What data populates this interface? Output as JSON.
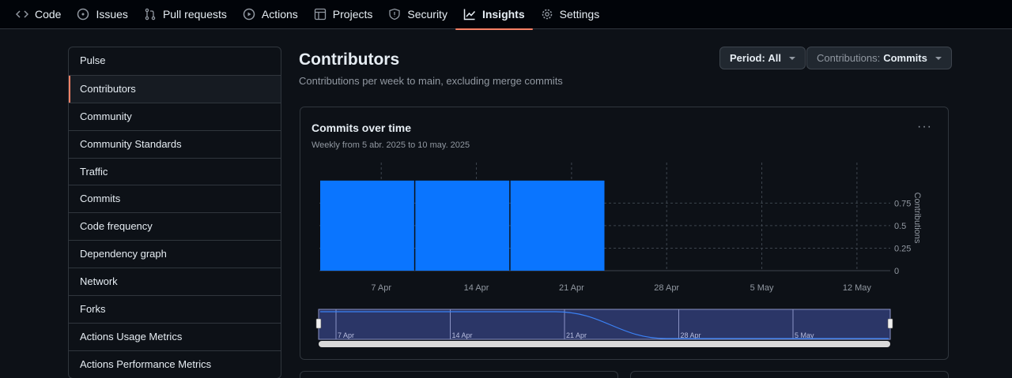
{
  "nav": {
    "tabs": [
      {
        "label": "Code",
        "icon": "code-icon"
      },
      {
        "label": "Issues",
        "icon": "issue-icon"
      },
      {
        "label": "Pull requests",
        "icon": "pull-request-icon"
      },
      {
        "label": "Actions",
        "icon": "play-icon"
      },
      {
        "label": "Projects",
        "icon": "table-icon"
      },
      {
        "label": "Security",
        "icon": "shield-icon"
      },
      {
        "label": "Insights",
        "icon": "graph-icon",
        "active": true
      },
      {
        "label": "Settings",
        "icon": "gear-icon"
      }
    ]
  },
  "sidebar": {
    "items": [
      {
        "label": "Pulse"
      },
      {
        "label": "Contributors",
        "active": true
      },
      {
        "label": "Community"
      },
      {
        "label": "Community Standards"
      },
      {
        "label": "Traffic"
      },
      {
        "label": "Commits"
      },
      {
        "label": "Code frequency"
      },
      {
        "label": "Dependency graph"
      },
      {
        "label": "Network"
      },
      {
        "label": "Forks"
      },
      {
        "label": "Actions Usage Metrics"
      },
      {
        "label": "Actions Performance Metrics"
      }
    ]
  },
  "main": {
    "title": "Contributors",
    "subtitle": "Contributions per week to main, excluding merge commits",
    "period_button": {
      "label": "Period:",
      "value": "All"
    },
    "contributions_button": {
      "label": "Contributions:",
      "value": "Commits"
    }
  },
  "card": {
    "title": "Commits over time",
    "subtitle": "Weekly from 5 abr. 2025 to 10 may. 2025",
    "menu_label": "···"
  },
  "colors": {
    "bar": "#0a75ff",
    "accent": "#f78166"
  },
  "chart_data": {
    "type": "bar",
    "categories": [
      "7 Apr",
      "14 Apr",
      "21 Apr",
      "28 Apr",
      "5 May",
      "12 May"
    ],
    "values": [
      1,
      1,
      1,
      0,
      0,
      0
    ],
    "ylabel": "Contributions",
    "ylim": [
      0,
      1
    ],
    "yticks": [
      "0",
      "0.25",
      "0.5",
      "0.75"
    ],
    "ytick_values": [
      0,
      0.25,
      0.5,
      0.75
    ],
    "navigator_labels": [
      "7 Apr",
      "14 Apr",
      "21 Apr",
      "28 Apr",
      "5 May"
    ],
    "grid": true
  }
}
